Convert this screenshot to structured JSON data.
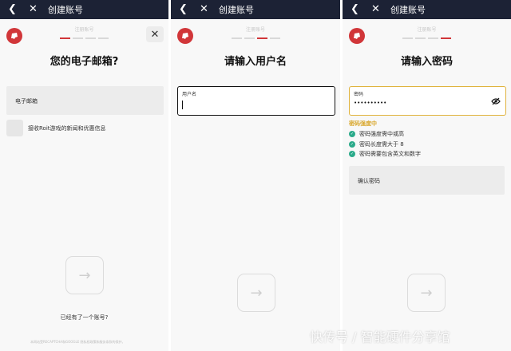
{
  "topbar": {
    "title": "创建账号"
  },
  "progress_label": "注册账号",
  "panel1": {
    "heading": "您的电子邮箱?",
    "email_label": "电子邮箱",
    "checkbox_label": "接收Roit游戏的新闻和优惠信息",
    "signin_text": "已经有了一个账号?",
    "footnote": "本网站受RECAPTCHA和GOOGLE 隐私权政策和服务条款的保护。"
  },
  "panel2": {
    "heading": "请输入用户名",
    "username_label": "用户名"
  },
  "panel3": {
    "heading": "请输入密码",
    "password_label": "密码",
    "password_value": "••••••••••",
    "strength_text": "密码强度中",
    "rules": [
      "密码强度需中或高",
      "密码长度需大于 8",
      "密码需要包含英文和数字"
    ],
    "confirm_label": "确认密码"
  },
  "watermark": "快传号 / 智能硬件分享馆",
  "colors": {
    "brand": "#d13639",
    "topbar": "#1c2235",
    "strength": "#d8a62a",
    "check": "#2aaa8a"
  }
}
